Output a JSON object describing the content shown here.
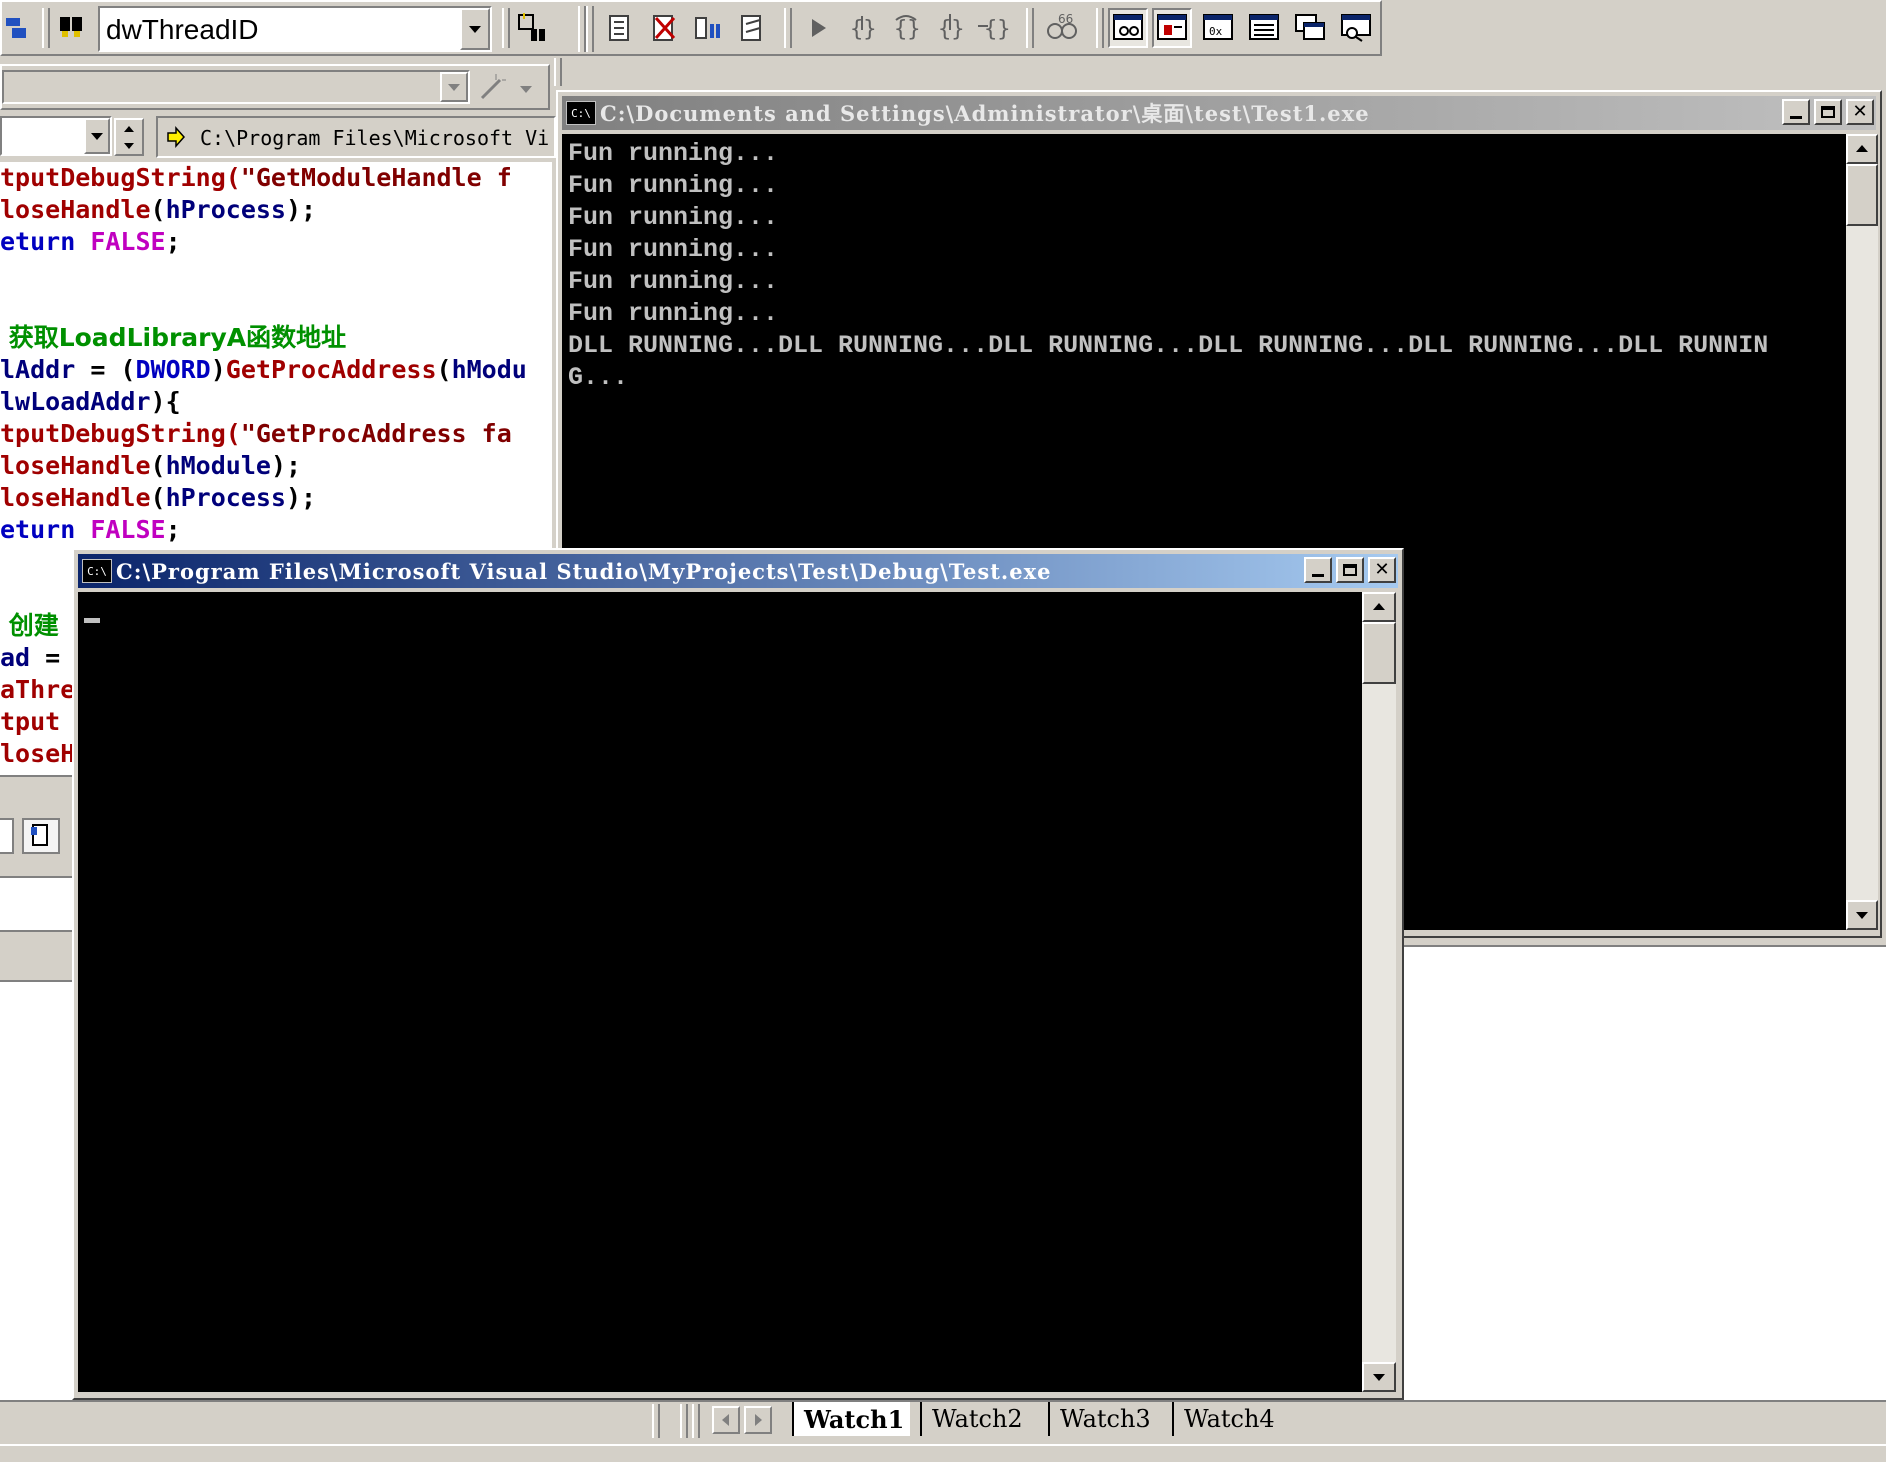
{
  "toolbar": {
    "combo_value": "dwThreadID",
    "path_combo_value": "C:\\Program Files\\Microsoft Vi"
  },
  "editor": {
    "lines": [
      [
        {
          "t": "tputDebugString(",
          "c": "red"
        },
        {
          "t": "\"GetModuleHandle f",
          "c": "brown"
        }
      ],
      [
        {
          "t": "loseHandle",
          "c": "red"
        },
        {
          "t": "(",
          "c": "black"
        },
        {
          "t": "hProcess",
          "c": "dark"
        },
        {
          "t": ");",
          "c": "black"
        }
      ],
      [
        {
          "t": "eturn ",
          "c": "blue"
        },
        {
          "t": "FALSE",
          "c": "pink"
        },
        {
          "t": ";",
          "c": "black"
        }
      ],
      [],
      [],
      [
        {
          "t": " 获取LoadLibraryA函数地址",
          "c": "green"
        }
      ],
      [
        {
          "t": "lAddr ",
          "c": "dark"
        },
        {
          "t": "= (",
          "c": "black"
        },
        {
          "t": "DWORD",
          "c": "blue"
        },
        {
          "t": ")",
          "c": "black"
        },
        {
          "t": "GetProcAddress",
          "c": "red"
        },
        {
          "t": "(",
          "c": "black"
        },
        {
          "t": "hModu",
          "c": "dark"
        }
      ],
      [
        {
          "t": "lwLoadAddr",
          "c": "dark"
        },
        {
          "t": "){",
          "c": "black"
        }
      ],
      [
        {
          "t": "tputDebugString(",
          "c": "red"
        },
        {
          "t": "\"GetProcAddress fa",
          "c": "brown"
        }
      ],
      [
        {
          "t": "loseHandle",
          "c": "red"
        },
        {
          "t": "(",
          "c": "black"
        },
        {
          "t": "hModule",
          "c": "dark"
        },
        {
          "t": ");",
          "c": "black"
        }
      ],
      [
        {
          "t": "loseHandle",
          "c": "red"
        },
        {
          "t": "(",
          "c": "black"
        },
        {
          "t": "hProcess",
          "c": "dark"
        },
        {
          "t": ");",
          "c": "black"
        }
      ],
      [
        {
          "t": "eturn ",
          "c": "blue"
        },
        {
          "t": "FALSE",
          "c": "pink"
        },
        {
          "t": ";",
          "c": "black"
        }
      ],
      [],
      [],
      [
        {
          "t": " 创建",
          "c": "green"
        }
      ],
      [
        {
          "t": "ad ",
          "c": "dark"
        },
        {
          "t": "=",
          "c": "black"
        }
      ],
      [
        {
          "t": "aThre",
          "c": "red"
        }
      ],
      [
        {
          "t": "tput",
          "c": "red"
        }
      ],
      [
        {
          "t": "loseH",
          "c": "red"
        }
      ]
    ]
  },
  "console1": {
    "title": "C:\\Documents and Settings\\Administrator\\桌面\\test\\Test1.exe",
    "icon_label": "C:\\",
    "output": "Fun running...\nFun running...\nFun running...\nFun running...\nFun running...\nFun running...\nDLL RUNNING...DLL RUNNING...DLL RUNNING...DLL RUNNING...DLL RUNNING...DLL RUNNIN\nG..."
  },
  "console2": {
    "title": "C:\\Program Files\\Microsoft Visual Studio\\MyProjects\\Test\\Debug\\Test.exe",
    "icon_label": "C:\\",
    "output": ""
  },
  "watch_tabs": [
    "Watch1",
    "Watch2",
    "Watch3",
    "Watch4"
  ],
  "icons": [
    "find-in-files-icon",
    "quick-watch-icon",
    "step-into-icon",
    "step-over-icon",
    "step-out-icon",
    "run-to-cursor-icon",
    "watch-window-icon",
    "variables-window-icon",
    "registers-window-icon",
    "memory-window-icon",
    "call-stack-window-icon",
    "disassembly-window-icon"
  ],
  "colors": {
    "code_red": "#a00000",
    "code_blue": "#0000c0",
    "code_pink": "#c000c0",
    "code_green": "#009000",
    "active_title_start": "#0a246a",
    "active_title_end": "#a6caf0",
    "console_bg": "#000000",
    "console_fg": "#c0c0c0"
  }
}
